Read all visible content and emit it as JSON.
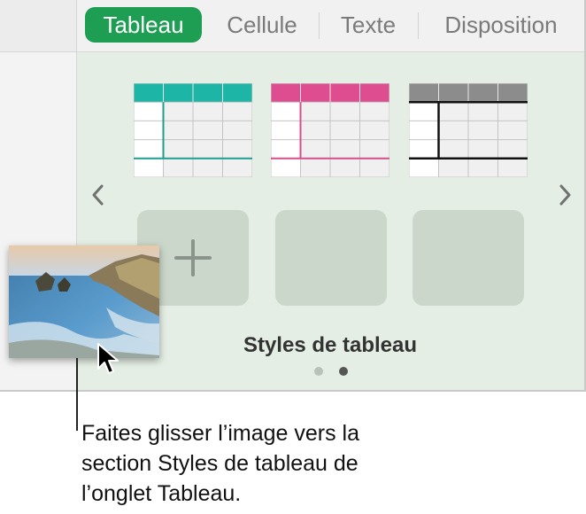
{
  "tabs": [
    {
      "label": "Tableau",
      "active": true
    },
    {
      "label": "Cellule",
      "active": false
    },
    {
      "label": "Texte",
      "active": false
    },
    {
      "label": "Disposition",
      "active": false
    }
  ],
  "table_styles": [
    {
      "accent_color": "#1db5a6",
      "line_color": "#1e9e8f"
    },
    {
      "accent_color": "#dd4d8f",
      "line_color": "#d44f8c"
    },
    {
      "accent_color": "#8c8c8c",
      "line_color": "#111111"
    }
  ],
  "nav": {
    "prev_icon": "chevron-left-icon",
    "next_icon": "chevron-right-icon"
  },
  "add_style_icon": "plus-icon",
  "panel_title": "Styles de tableau",
  "page_indicator": {
    "pages": 2,
    "current": 2
  },
  "callout_lines": [
    "Faites glisser l’image vers la",
    "section Styles de tableau de",
    "l’onglet Tableau."
  ],
  "colors": {
    "accent_green": "#1e9e52",
    "panel_bg": "#e4eee4",
    "slot_bg": "#cbd7cb"
  }
}
